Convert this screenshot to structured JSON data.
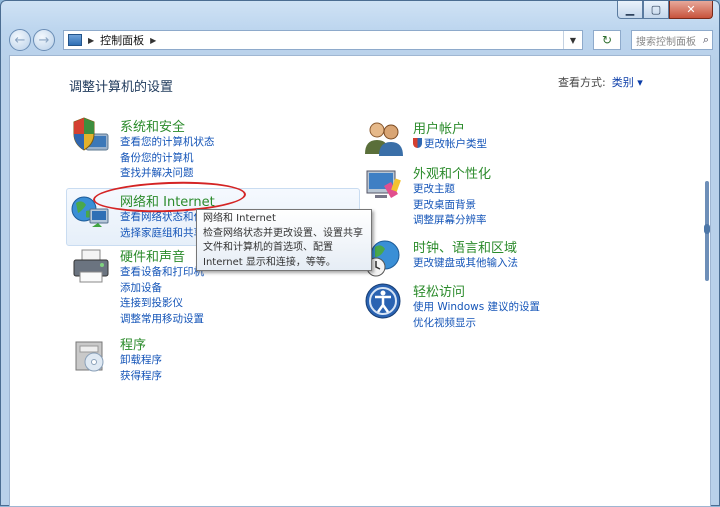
{
  "window": {
    "title_buttons": [
      "minimize",
      "maximize",
      "close"
    ]
  },
  "nav": {
    "back_glyph": "←",
    "forward_glyph": "→",
    "breadcrumb": "控制面板",
    "refresh_glyph": "↻",
    "search_placeholder": "搜索控制面板",
    "search_icon_glyph": "⌕"
  },
  "page": {
    "heading": "调整计算机的设置",
    "view_by_label": "查看方式:",
    "view_by_value": "类别 ▾"
  },
  "categories_left": [
    {
      "title": "系统和安全",
      "links": [
        "查看您的计算机状态",
        "备份您的计算机",
        "查找并解决问题"
      ]
    },
    {
      "title": "网络和 Internet",
      "links": [
        "查看网络状态和任务",
        "选择家庭组和共享选项"
      ]
    },
    {
      "title": "硬件和声音",
      "links": [
        "查看设备和打印机",
        "添加设备",
        "连接到投影仪",
        "调整常用移动设置"
      ]
    },
    {
      "title": "程序",
      "links": [
        "卸载程序",
        "获得程序"
      ]
    }
  ],
  "categories_right": [
    {
      "title": "用户帐户",
      "links": [
        "更改帐户类型"
      ]
    },
    {
      "title": "外观和个性化",
      "links": [
        "更改主题",
        "更改桌面背景",
        "调整屏幕分辨率"
      ]
    },
    {
      "title": "时钟、语言和区域",
      "links": [
        "更改键盘或其他输入法"
      ]
    },
    {
      "title": "轻松访问",
      "links": [
        "使用 Windows 建议的设置",
        "优化视频显示"
      ]
    }
  ],
  "tooltip": {
    "line1": "网络和 Internet",
    "line2": "检查网络状态并更改设置、设置共享",
    "line3": "文件和计算机的首选项、配置",
    "line4": "Internet 显示和连接，等等。"
  },
  "colors": {
    "category_title": "#2b8b2b",
    "link": "#1555b8",
    "annotation": "#d42424"
  }
}
